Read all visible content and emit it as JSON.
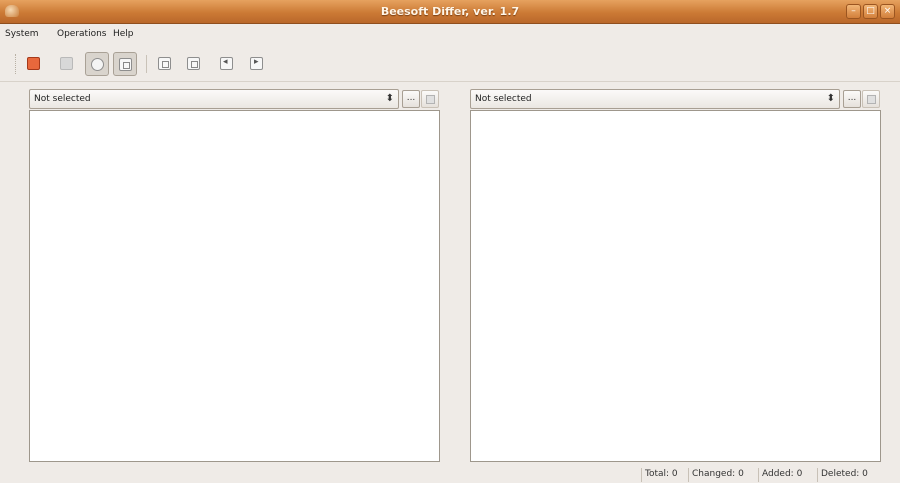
{
  "window": {
    "title": "Beesoft Differ, ver. 1.7",
    "controls": [
      "minimize",
      "maximize",
      "close"
    ]
  },
  "menubar": {
    "items": [
      {
        "label": "System"
      },
      {
        "label": "Operations"
      },
      {
        "label": "Help"
      }
    ]
  },
  "toolbar": {
    "buttons": [
      {
        "icon": "stop-icon"
      },
      {
        "icon": "save-icon"
      },
      {
        "icon": "diff-mode-icon",
        "toggled": true
      },
      {
        "icon": "compare-view-icon",
        "toggled": true
      },
      {
        "icon": "left-document-icon"
      },
      {
        "icon": "right-document-icon"
      },
      {
        "icon": "move-left-icon"
      },
      {
        "icon": "move-right-icon"
      }
    ]
  },
  "left_panel": {
    "file_select": "Not selected",
    "browse_label": "..."
  },
  "right_panel": {
    "file_select": "Not selected",
    "browse_label": "..."
  },
  "statusbar": {
    "total": "Total: 0",
    "changed": "Changed: 0",
    "added": "Added: 0",
    "deleted": "Deleted: 0"
  },
  "colors": {
    "titlebar": "#cc7a35",
    "window_bg": "#efebe7",
    "content_bg": "#ffffff"
  }
}
